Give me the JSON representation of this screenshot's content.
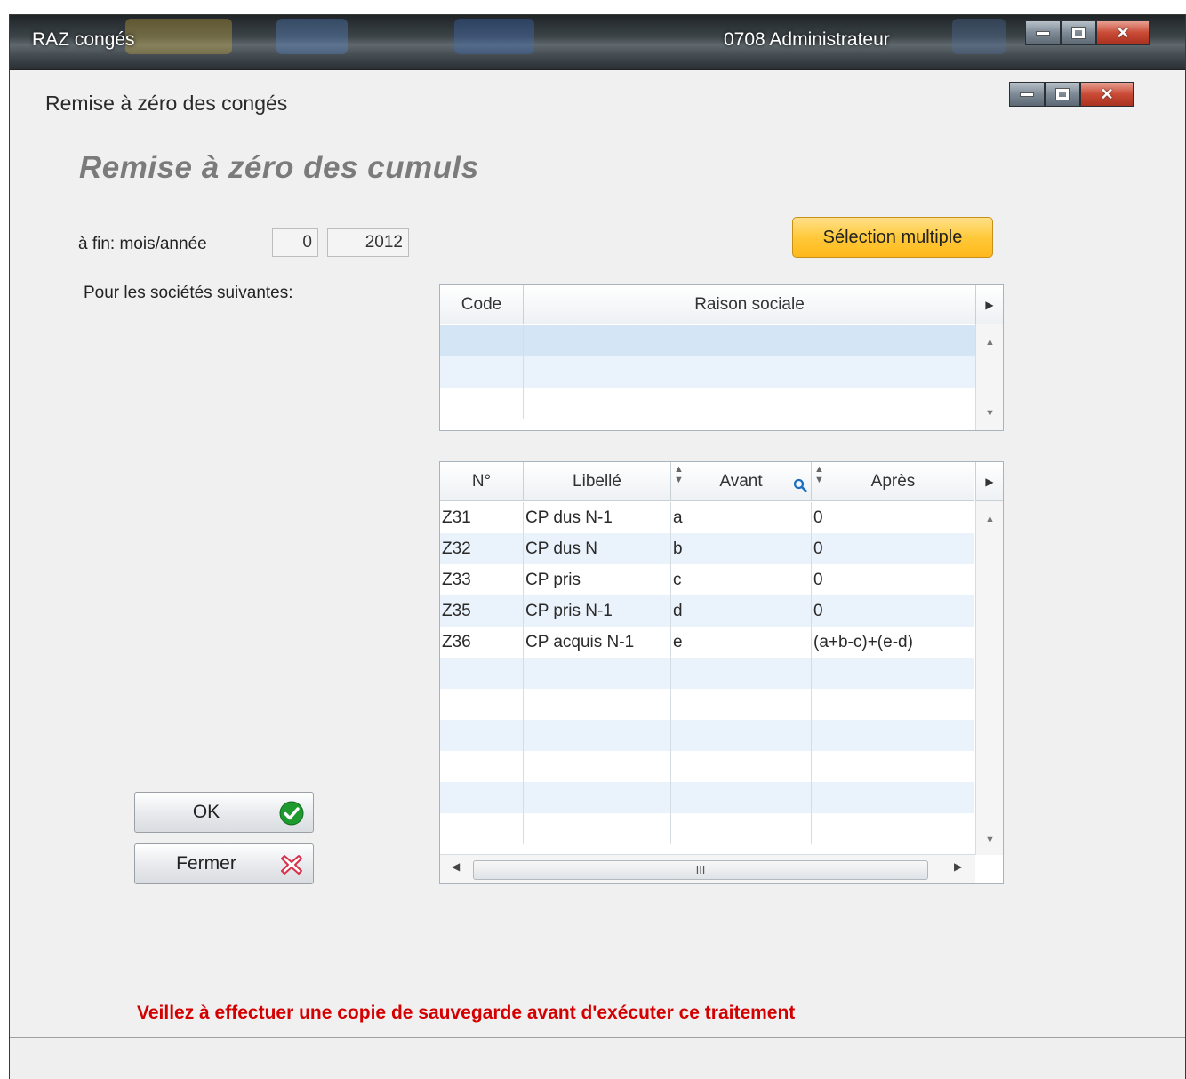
{
  "outer_window": {
    "title": "RAZ congés",
    "user": "0708 Administrateur"
  },
  "inner_window": {
    "title": "Remise à zéro des congés"
  },
  "heading": "Remise à zéro des cumuls",
  "period": {
    "label": "à fin: mois/année",
    "month": "0",
    "year": "2012"
  },
  "multi_select_label": "Sélection multiple",
  "companies_label": "Pour les sociétés suivantes:",
  "companies_table": {
    "columns": [
      "Code",
      "Raison sociale"
    ],
    "rows": []
  },
  "counters_table": {
    "columns": [
      "N°",
      "Libellé",
      "Avant",
      "Après"
    ],
    "rows": [
      [
        "Z31",
        "CP dus N-1",
        "a",
        "0"
      ],
      [
        "Z32",
        "CP dus N",
        "b",
        "0"
      ],
      [
        "Z33",
        "CP pris",
        "c",
        "0"
      ],
      [
        "Z35",
        "CP pris N-1",
        "d",
        "0"
      ],
      [
        "Z36",
        "CP acquis N-1",
        "e",
        "(a+b-c)+(e-d)"
      ]
    ],
    "hscroll_label": "III"
  },
  "buttons": {
    "ok": "OK",
    "close": "Fermer"
  },
  "warning": "Veillez à effectuer une copie de sauvegarde avant d'exécuter ce traitement",
  "colors": {
    "warning": "#d40000",
    "multi_select": "#ffc93a",
    "heading": "#7b7b7b",
    "row_alt": "#eaf2fb"
  }
}
